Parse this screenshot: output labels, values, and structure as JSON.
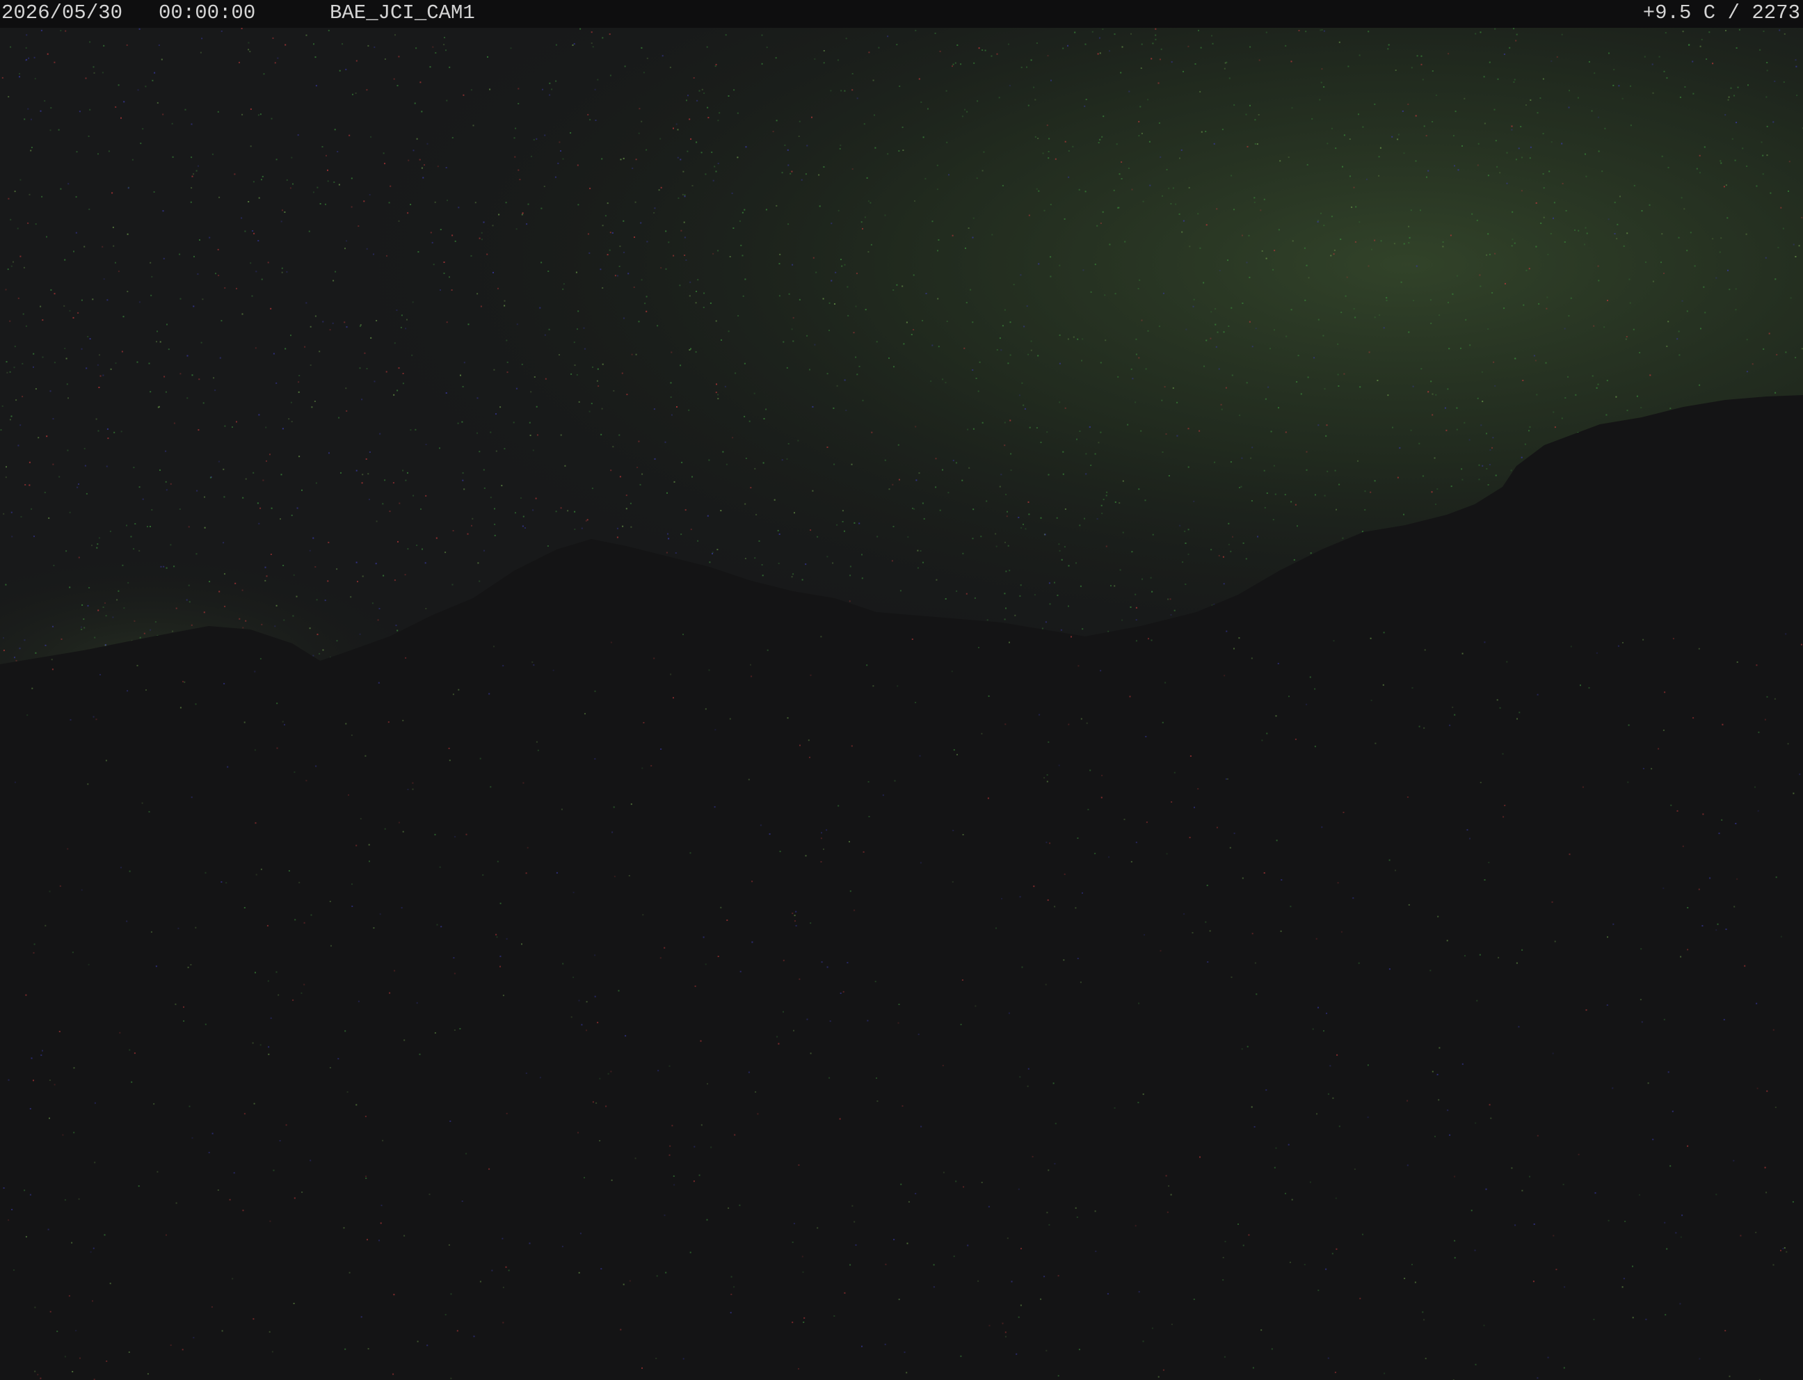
{
  "overlay": {
    "date": "2026/05/30",
    "time": "00:00:00",
    "camera_id": "BAE_JCI_CAM1",
    "sensor_readout": "+9.5 C / 2273"
  },
  "scene": {
    "sky_color": "#1b1f1a",
    "glow_color": "#2c3a24",
    "ground_color": "#141415",
    "noise_colors": [
      "#c0393b",
      "#3a8a3a",
      "#3a3aa8",
      "#6a9a4a"
    ]
  }
}
